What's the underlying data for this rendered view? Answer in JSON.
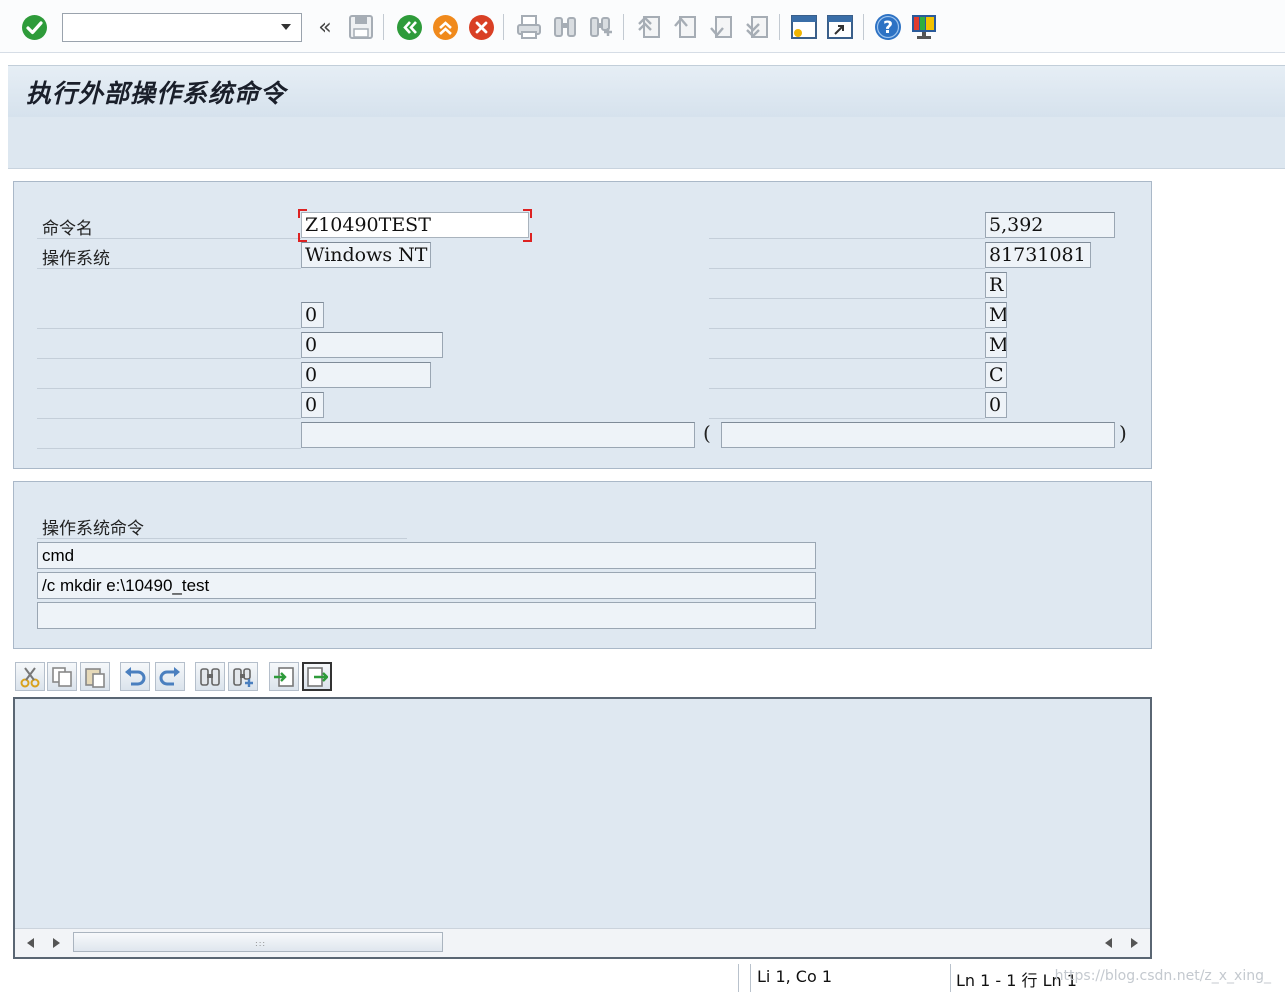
{
  "colors": {
    "accent_green": "#2e9b3a",
    "accent_orange": "#f08a1c",
    "accent_red": "#d94025",
    "panel_bg": "#dfe8f1",
    "help_blue": "#2d72c4"
  },
  "toolbar": {
    "command_field_value": "",
    "icons": [
      "enter-check-icon",
      "command-dropdown-icon",
      "collapse-icon",
      "save-icon",
      "back-icon",
      "exit-icon",
      "cancel-icon",
      "print-icon",
      "find-icon",
      "find-next-icon",
      "first-page-icon",
      "previous-page-icon",
      "next-page-icon",
      "last-page-icon",
      "create-session-icon",
      "shortcut-icon",
      "help-icon",
      "layout-icon"
    ]
  },
  "title": "执行外部操作系统命令",
  "form": {
    "left": [
      {
        "label": "命令名",
        "value": "Z10490TEST"
      },
      {
        "label": "操作系统",
        "value": "Windows NT"
      },
      {
        "label": "",
        "value": ""
      },
      {
        "label": "",
        "value": "0"
      },
      {
        "label": "",
        "value": "0"
      },
      {
        "label": "",
        "value": "0"
      },
      {
        "label": "",
        "value": "0"
      },
      {
        "label": "",
        "value": ""
      }
    ],
    "right": [
      {
        "value": "5,392"
      },
      {
        "value": "81731081"
      },
      {
        "value": "R"
      },
      {
        "value": "M"
      },
      {
        "value": "M"
      },
      {
        "value": "C"
      },
      {
        "value": "0"
      },
      {
        "value": ""
      }
    ],
    "paren_open": "(",
    "paren_close": ")"
  },
  "os_command": {
    "label": "操作系统命令",
    "lines": [
      "cmd",
      "/c mkdir e:\\10490_test",
      ""
    ]
  },
  "editor": {
    "icons": [
      "cut-icon",
      "copy-icon",
      "paste-icon",
      "undo-icon",
      "redo-icon",
      "find-icon",
      "find-next-icon",
      "import-icon",
      "export-icon"
    ],
    "content": ""
  },
  "status": {
    "cursor": "Li 1, Co 1",
    "lines": "Ln 1 - 1 行 Ln 1",
    "watermark": "https://blog.csdn.net/z_x_xing_"
  }
}
